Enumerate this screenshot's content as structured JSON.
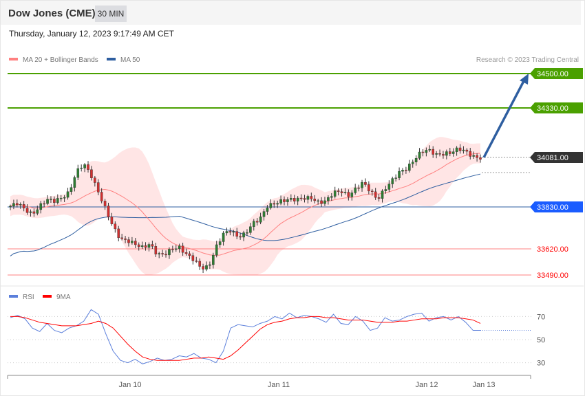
{
  "header": {
    "title": "Dow Jones (CME)",
    "timeframe": "30 MIN",
    "datetime": "Thursday, January 12, 2023 9:17:49 AM CET"
  },
  "colors": {
    "ma20": "#ff8080",
    "ma50": "#2e5ea0",
    "target": "#4aa000",
    "current": "#333333",
    "support": "#1a5cff",
    "resistance": "#ff0000",
    "arrow": "#2e5ea0"
  },
  "chart_data": [
    {
      "type": "candlestick",
      "title": "Dow Jones (CME) 30 MIN",
      "legend": [
        {
          "label": "MA 20 + Bollinger Bands",
          "color": "#ff8080"
        },
        {
          "label": "MA 50",
          "color": "#2e5ea0"
        }
      ],
      "legend_position": "top-left",
      "copyright": "Research © 2023 Trading Central",
      "ylim": [
        33470,
        34520
      ],
      "closes": [
        33835,
        33852,
        33818,
        33793,
        33835,
        33869,
        33862,
        33876,
        33904,
        34007,
        34048,
        33990,
        33904,
        33818,
        33731,
        33669,
        33662,
        33645,
        33628,
        33645,
        33593,
        33593,
        33621,
        33628,
        33593,
        33566,
        33524,
        33531,
        33628,
        33697,
        33714,
        33680,
        33697,
        33749,
        33773,
        33835,
        33849,
        33862,
        33869,
        33869,
        33876,
        33876,
        33852,
        33862,
        33904,
        33911,
        33886,
        33921,
        33955,
        33911,
        33869,
        33921,
        33966,
        34007,
        34024,
        34069,
        34110,
        34117,
        34093,
        34097,
        34104,
        34124,
        34110,
        34083,
        34076
      ],
      "levels": [
        {
          "value": "34500.00",
          "type": "target"
        },
        {
          "value": "34330.00",
          "type": "target"
        },
        {
          "value": "34081.00",
          "type": "current"
        },
        {
          "value": "33830.00",
          "type": "support"
        },
        {
          "value": "33620.00",
          "type": "resistance"
        },
        {
          "value": "33490.00",
          "type": "resistance"
        }
      ],
      "projection": {
        "from": 34081,
        "to": 34500
      },
      "xticks": [
        "Jan 10",
        "Jan 11",
        "Jan 12",
        "Jan 13"
      ]
    },
    {
      "type": "line",
      "title": "RSI",
      "legend": [
        {
          "label": "RSI",
          "color": "#5b7fdb"
        },
        {
          "label": "9MA",
          "color": "#ff0000"
        }
      ],
      "ylim": [
        20,
        80
      ],
      "yticks": [
        "70",
        "50",
        "30"
      ],
      "rsi": [
        69,
        71,
        68,
        60,
        57,
        64,
        58,
        56,
        60,
        62,
        66,
        76,
        72,
        55,
        40,
        32,
        30,
        33,
        29,
        31,
        34,
        32,
        33,
        36,
        35,
        38,
        34,
        33,
        30,
        40,
        60,
        63,
        62,
        61,
        64,
        66,
        70,
        68,
        73,
        69,
        71,
        70,
        68,
        65,
        72,
        64,
        63,
        70,
        66,
        58,
        60,
        69,
        66,
        67,
        70,
        72,
        73,
        66,
        69,
        70,
        67,
        70,
        65,
        58,
        58
      ],
      "ma9": [
        70,
        70,
        69,
        67,
        65,
        64,
        63,
        62,
        62,
        62,
        63,
        64,
        66,
        64,
        60,
        53,
        46,
        40,
        35,
        33,
        32,
        32,
        32,
        32,
        33,
        34,
        34,
        35,
        34,
        33,
        36,
        41,
        47,
        53,
        59,
        63,
        65,
        66,
        68,
        69,
        69,
        70,
        70,
        69,
        69,
        68,
        67,
        67,
        67,
        66,
        65,
        65,
        65,
        66,
        66,
        67,
        68,
        68,
        68,
        69,
        69,
        69,
        68,
        67,
        64
      ]
    }
  ]
}
